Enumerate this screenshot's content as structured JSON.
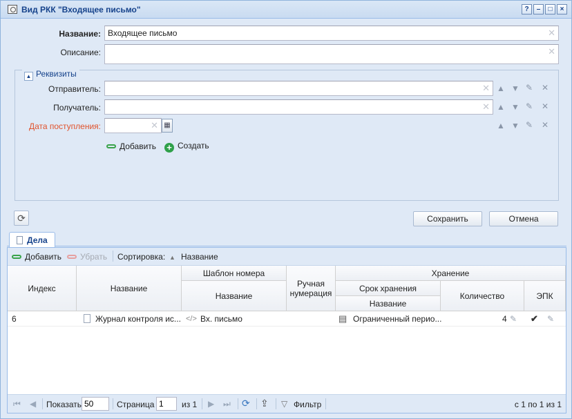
{
  "window": {
    "title": "Вид РКК \"Входящее письмо\"",
    "buttons": [
      "?",
      "–",
      "□",
      "×"
    ]
  },
  "form": {
    "name_label": "Название:",
    "name_value": "Входящее письмо",
    "description_label": "Описание:",
    "description_value": "",
    "requisites": {
      "legend": "Реквизиты",
      "fields": [
        {
          "label": "Отправитель:",
          "value": "",
          "required": false
        },
        {
          "label": "Получатель:",
          "value": "",
          "required": false
        },
        {
          "label": "Дата поступления:",
          "value": "",
          "required": true
        }
      ],
      "add_label": "Добавить",
      "create_label": "Создать"
    },
    "save_label": "Сохранить",
    "cancel_label": "Отмена"
  },
  "tabs": [
    {
      "label": "Дела",
      "active": true
    }
  ],
  "grid": {
    "toolbar": {
      "add_label": "Добавить",
      "remove_label": "Убрать",
      "sort_label": "Сортировка:",
      "sort_field": "Название"
    },
    "headers": {
      "index": "Индекс",
      "name": "Название",
      "number_template": "Шаблон номера",
      "number_template_name": "Название",
      "manual_numbering": "Ручная нумерация",
      "storage": "Хранение",
      "storage_period": "Срок хранения",
      "storage_period_name": "Название",
      "quantity": "Количество",
      "epk": "ЭПК"
    },
    "rows": [
      {
        "index": "6",
        "name": "Журнал контроля ис...",
        "template": "Вх. письмо",
        "manual": "",
        "period": "Ограниченный перио...",
        "quantity": "4",
        "epk": "✔"
      }
    ]
  },
  "pager": {
    "show_label": "Показать",
    "page_size": "50",
    "page_label": "Страница",
    "page": "1",
    "of_label": "из 1",
    "filter_label": "Фильтр",
    "summary": "с 1 по 1 из 1"
  },
  "colors": {
    "accent": "#15428b",
    "required_label": "#e0522c",
    "panel_bg": "#dfe9f6"
  }
}
